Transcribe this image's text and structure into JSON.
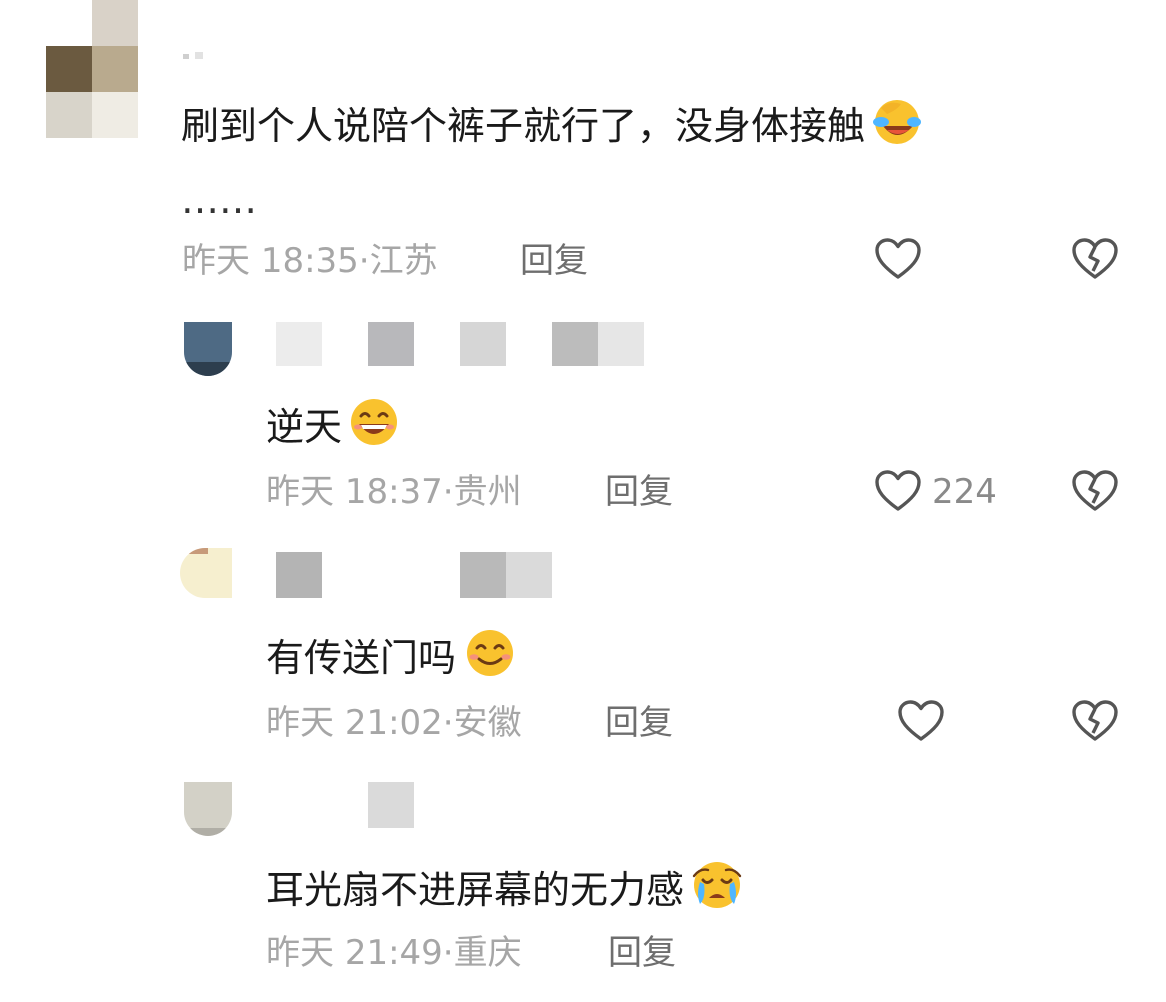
{
  "comments": [
    {
      "text": "刷到个人说陪个裤子就行了，没身体接触",
      "continuation": "……",
      "emoji": "laughing-cover-face",
      "date": "昨天",
      "time": "18:35",
      "location": "江苏",
      "reply_label": "回复",
      "likes": ""
    },
    {
      "text": "逆天",
      "emoji": "grinning",
      "date": "昨天",
      "time": "18:37",
      "location": "贵州",
      "reply_label": "回复",
      "likes": "224"
    },
    {
      "text": "有传送门吗",
      "emoji": "smiling",
      "date": "昨天",
      "time": "21:02",
      "location": "安徽",
      "reply_label": "回复",
      "likes": ""
    },
    {
      "text": "耳光扇不进屏幕的无力感",
      "emoji": "crying-face",
      "date": "昨天",
      "time": "21:49",
      "location": "重庆",
      "reply_label": "回复",
      "likes": ""
    }
  ],
  "separator": "·",
  "icons": {
    "like": "heart-outline-icon",
    "dislike": "broken-heart-icon"
  },
  "colors": {
    "text": "#1a1a1a",
    "meta": "#a6a6a6",
    "reply": "#6e6e6e",
    "icon": "#555555",
    "emoji_face": "#f9c22e"
  }
}
